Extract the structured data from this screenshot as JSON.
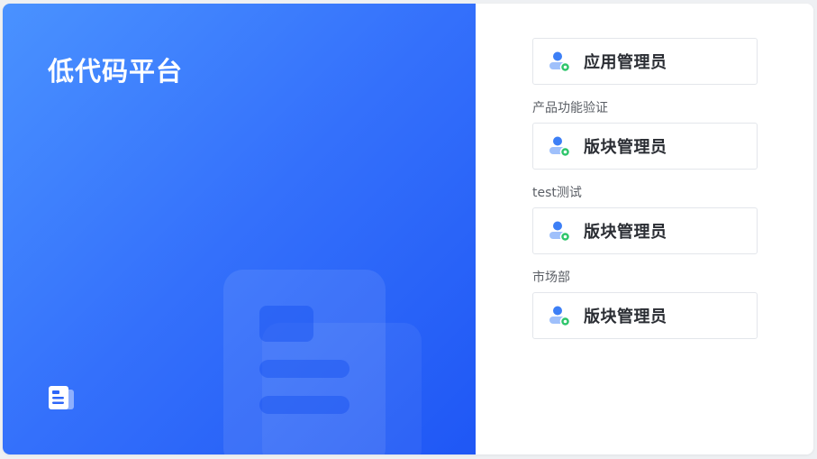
{
  "platform": {
    "title": "低代码平台"
  },
  "roles": [
    {
      "group_label": "",
      "role_label": "应用管理员",
      "icon": "user-admin-icon"
    },
    {
      "group_label": "产品功能验证",
      "role_label": "版块管理员",
      "icon": "user-admin-icon"
    },
    {
      "group_label": "test测试",
      "role_label": "版块管理员",
      "icon": "user-admin-icon"
    },
    {
      "group_label": "市场部",
      "role_label": "版块管理员",
      "icon": "user-admin-icon"
    }
  ],
  "colors": {
    "panel_gradient_start": "#4a92ff",
    "panel_gradient_end": "#1f57f5",
    "avatar_blue": "#3d7ff6",
    "badge_green": "#2ec56b"
  }
}
